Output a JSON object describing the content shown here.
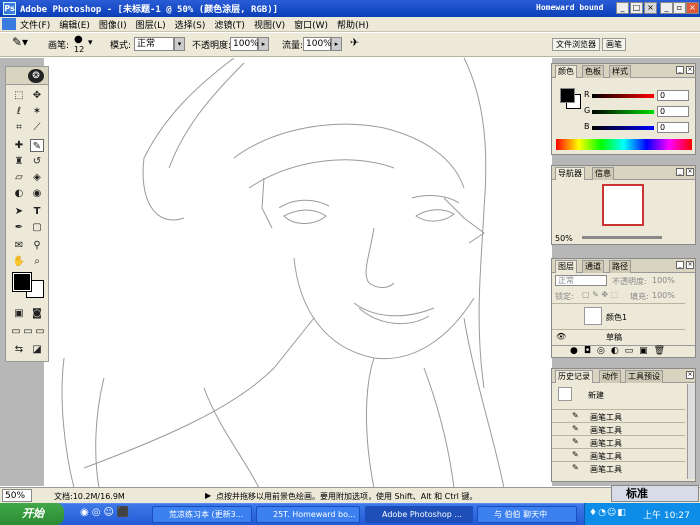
{
  "window": {
    "title": "Adobe Photoshop - [未标题-1 @ 50% (颜色涂层, RGB)]",
    "right_title": "Homeward bound"
  },
  "menu": [
    "文件(F)",
    "编辑(E)",
    "图像(I)",
    "图层(L)",
    "选择(S)",
    "滤镜(T)",
    "视图(V)",
    "窗口(W)",
    "帮助(H)"
  ],
  "options": {
    "brush_label": "画笔:",
    "brush_size": "12",
    "mode_label": "模式:",
    "mode_value": "正常",
    "opacity_label": "不透明度:",
    "opacity_value": "100%",
    "flow_label": "流量:",
    "flow_value": "100%",
    "palette_tab_1": "文件浏览器",
    "palette_tab_2": "画笔"
  },
  "color_panel": {
    "tabs": [
      "颜色",
      "色板",
      "样式"
    ],
    "r_label": "R",
    "g_label": "G",
    "b_label": "B",
    "r": "0",
    "g": "0",
    "b": "0"
  },
  "navigator_panel": {
    "tabs": [
      "导航器",
      "信息"
    ],
    "zoom": "50%"
  },
  "layers_panel": {
    "tabs": [
      "图层",
      "通道",
      "路径"
    ],
    "mode": "正常",
    "opacity_label": "不透明度:",
    "opacity": "100%",
    "lock_label": "锁定:",
    "fill_label": "填充:",
    "fill": "100%",
    "layers": [
      "颜色1",
      "草稿"
    ]
  },
  "history_panel": {
    "tabs": [
      "历史记录",
      "动作",
      "工具预设"
    ],
    "snapshot": "新建",
    "items": [
      "画笔工具",
      "画笔工具",
      "画笔工具",
      "画笔工具",
      "画笔工具"
    ]
  },
  "status": {
    "zoom": "50%",
    "doc": "文档:10.2M/16.9M",
    "hint": "点按并拖移以用前景色绘画。要用附加选项，使用 Shift、Alt 和 Ctrl 键。"
  },
  "taskbar": {
    "start": "开始",
    "tasks": [
      "荒凉练习本 (更新3...",
      "25T. Homeward bo...",
      "Adobe Photoshop ...",
      "与 伯伯 聊天中"
    ],
    "ime": "标准",
    "clock": "上午 10:27"
  },
  "colors": {
    "titlebar": "#0a3fb8",
    "accent": "#245ad6"
  }
}
